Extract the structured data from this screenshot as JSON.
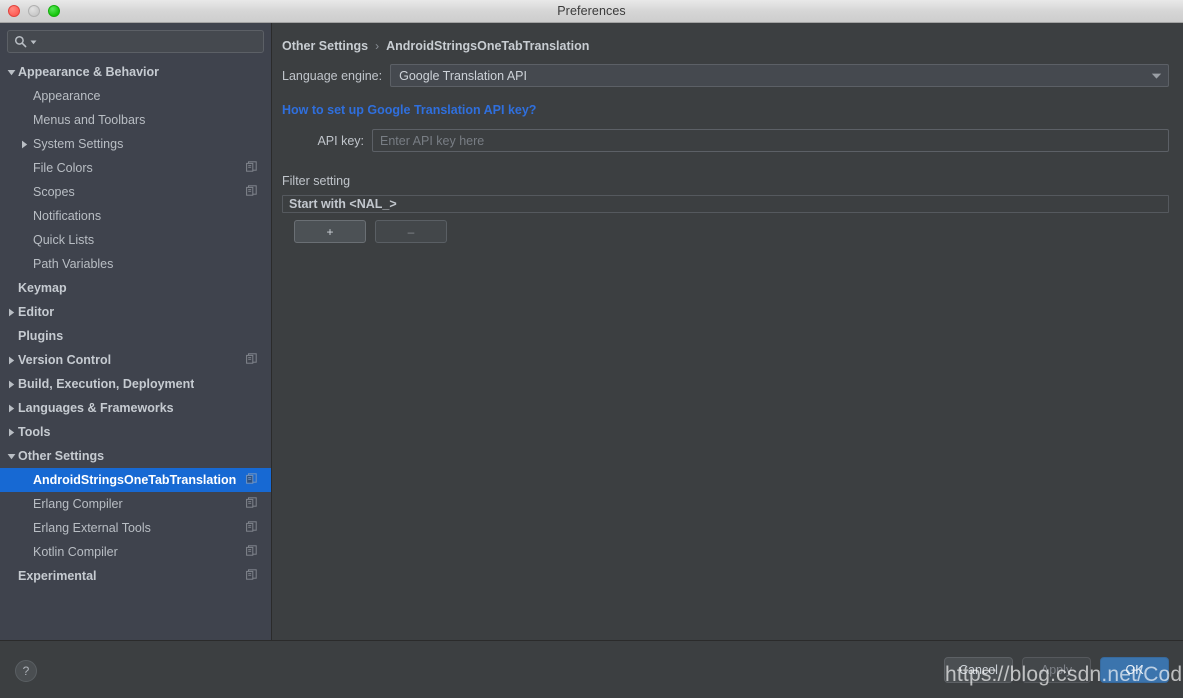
{
  "window": {
    "title": "Preferences",
    "traffic_lights": [
      "close",
      "minimize",
      "zoom"
    ]
  },
  "sidebar": {
    "search": {
      "value": "",
      "placeholder": "",
      "icon": "search-icon",
      "dropdown_icon": "chevron-down-icon"
    },
    "items": [
      {
        "label": "Appearance & Behavior",
        "indent": 0,
        "bold": true,
        "twisty": "down",
        "copy_icon": false,
        "selected": false
      },
      {
        "label": "Appearance",
        "indent": 1,
        "bold": false,
        "twisty": "none",
        "copy_icon": false,
        "selected": false
      },
      {
        "label": "Menus and Toolbars",
        "indent": 1,
        "bold": false,
        "twisty": "none",
        "copy_icon": false,
        "selected": false
      },
      {
        "label": "System Settings",
        "indent": 1,
        "bold": false,
        "twisty": "right",
        "copy_icon": false,
        "selected": false
      },
      {
        "label": "File Colors",
        "indent": 1,
        "bold": false,
        "twisty": "none",
        "copy_icon": true,
        "selected": false
      },
      {
        "label": "Scopes",
        "indent": 1,
        "bold": false,
        "twisty": "none",
        "copy_icon": true,
        "selected": false
      },
      {
        "label": "Notifications",
        "indent": 1,
        "bold": false,
        "twisty": "none",
        "copy_icon": false,
        "selected": false
      },
      {
        "label": "Quick Lists",
        "indent": 1,
        "bold": false,
        "twisty": "none",
        "copy_icon": false,
        "selected": false
      },
      {
        "label": "Path Variables",
        "indent": 1,
        "bold": false,
        "twisty": "none",
        "copy_icon": false,
        "selected": false
      },
      {
        "label": "Keymap",
        "indent": 0,
        "bold": true,
        "twisty": "none",
        "copy_icon": false,
        "selected": false
      },
      {
        "label": "Editor",
        "indent": 0,
        "bold": true,
        "twisty": "right",
        "copy_icon": false,
        "selected": false
      },
      {
        "label": "Plugins",
        "indent": 0,
        "bold": true,
        "twisty": "none",
        "copy_icon": false,
        "selected": false
      },
      {
        "label": "Version Control",
        "indent": 0,
        "bold": true,
        "twisty": "right",
        "copy_icon": true,
        "selected": false
      },
      {
        "label": "Build, Execution, Deployment",
        "indent": 0,
        "bold": true,
        "twisty": "right",
        "copy_icon": false,
        "selected": false
      },
      {
        "label": "Languages & Frameworks",
        "indent": 0,
        "bold": true,
        "twisty": "right",
        "copy_icon": false,
        "selected": false
      },
      {
        "label": "Tools",
        "indent": 0,
        "bold": true,
        "twisty": "right",
        "copy_icon": false,
        "selected": false
      },
      {
        "label": "Other Settings",
        "indent": 0,
        "bold": true,
        "twisty": "down",
        "copy_icon": false,
        "selected": false
      },
      {
        "label": "AndroidStringsOneTabTranslation",
        "indent": 1,
        "bold": false,
        "twisty": "none",
        "copy_icon": true,
        "selected": true
      },
      {
        "label": "Erlang Compiler",
        "indent": 1,
        "bold": false,
        "twisty": "none",
        "copy_icon": true,
        "selected": false
      },
      {
        "label": "Erlang External Tools",
        "indent": 1,
        "bold": false,
        "twisty": "none",
        "copy_icon": true,
        "selected": false
      },
      {
        "label": "Kotlin Compiler",
        "indent": 1,
        "bold": false,
        "twisty": "none",
        "copy_icon": true,
        "selected": false
      },
      {
        "label": "Experimental",
        "indent": 0,
        "bold": true,
        "twisty": "none",
        "copy_icon": true,
        "selected": false
      }
    ]
  },
  "main": {
    "breadcrumb": {
      "root": "Other Settings",
      "separator": "›",
      "current": "AndroidStringsOneTabTranslation"
    },
    "language_engine": {
      "label": "Language engine:",
      "value": "Google Translation API",
      "chevron_icon": "chevron-down-icon"
    },
    "help_link": "How to set up Google Translation API key?",
    "api_key": {
      "label": "API key:",
      "value": "",
      "placeholder": "Enter API key here"
    },
    "filter": {
      "title": "Filter setting",
      "items": [
        "Start with <NAL_>"
      ],
      "add_label": "+",
      "remove_label": "–"
    }
  },
  "bottom": {
    "help_label": "?",
    "cancel_label": "Cancel",
    "apply_label": "Apply",
    "ok_label": "OK"
  },
  "watermark": "https://blog.csdn.net/CoderYue",
  "colors": {
    "sidebar_bg": "#3f434d",
    "panel_bg": "#3c3f41",
    "selection_blue": "#1769d3",
    "link_blue": "#2f6fdd",
    "ok_button_blue": "#3b74ad",
    "text_primary": "#c0c5cb"
  }
}
